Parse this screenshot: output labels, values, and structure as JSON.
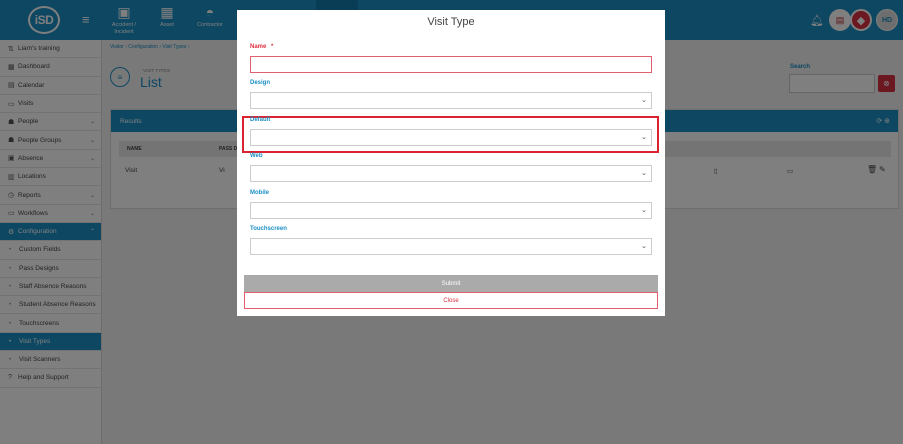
{
  "app": {
    "logo_text": "iSD",
    "hamburger": "≡"
  },
  "topnav": [
    {
      "label": "Accident / Incident",
      "icon": "clipboard-icon"
    },
    {
      "label": "Asset",
      "icon": "boxes-icon"
    },
    {
      "label": "Contractor",
      "icon": "hardhat-icon"
    }
  ],
  "topright": {
    "user_initials": "HD"
  },
  "sidebar": {
    "items": [
      {
        "label": "Liam's training",
        "icon": "swap-icon"
      },
      {
        "label": "Dashboard",
        "icon": "dashboard-icon"
      },
      {
        "label": "Calendar",
        "icon": "calendar-icon"
      },
      {
        "label": "Visits",
        "icon": "visits-icon"
      },
      {
        "label": "People",
        "icon": "people-icon",
        "chevron": "⌄"
      },
      {
        "label": "People Groups",
        "icon": "people-groups-icon",
        "chevron": "⌄"
      },
      {
        "label": "Absence",
        "icon": "absence-icon",
        "chevron": "⌄"
      },
      {
        "label": "Locations",
        "icon": "locations-icon"
      },
      {
        "label": "Reports",
        "icon": "reports-icon",
        "chevron": "⌄"
      },
      {
        "label": "Workflows",
        "icon": "workflows-icon",
        "chevron": "⌄"
      },
      {
        "label": "Configuration",
        "icon": "configuration-icon",
        "chevron": "⌃"
      }
    ],
    "sub_items": [
      {
        "label": "Custom Fields"
      },
      {
        "label": "Pass Designs"
      },
      {
        "label": "Staff Absence Reasons"
      },
      {
        "label": "Student Absence Reasons"
      },
      {
        "label": "Touchscreens"
      },
      {
        "label": "Visit Types"
      },
      {
        "label": "Visit Scanners"
      }
    ],
    "footer_item": {
      "label": "Help and Support",
      "icon": "help-icon"
    }
  },
  "breadcrumb": {
    "text": "Visitor  ›  Configuration  ›  Visit Types  ›"
  },
  "page": {
    "subtitle": "VISIT TYPES",
    "title": "List"
  },
  "search": {
    "label": "Search"
  },
  "results": {
    "title": "Results",
    "columns": [
      "NAME",
      "PASS D"
    ],
    "rows": [
      {
        "name": "Visit",
        "pass": "Vi"
      }
    ]
  },
  "modal": {
    "title": "Visit Type",
    "fields": {
      "name_label": "Name",
      "required_marker": "*",
      "design_label": "Design",
      "default_label": "Default",
      "web_label": "Web",
      "mobile_label": "Mobile",
      "touchscreen_label": "Touchscreen"
    },
    "submit_label": "Submit",
    "close_label": "Close"
  },
  "colors": {
    "brand": "#1a8fc4",
    "danger": "#d63040",
    "highlight": "#d9242f"
  }
}
